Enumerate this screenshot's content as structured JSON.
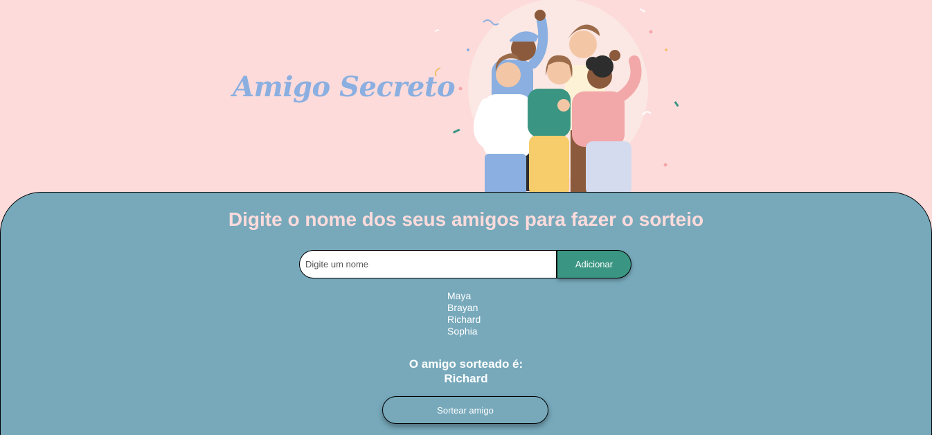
{
  "header": {
    "title": "Amigo Secreto"
  },
  "main": {
    "subtitle": "Digite o nome dos seus amigos para fazer o sorteio",
    "input_placeholder": "Digite um nome",
    "add_button_label": "Adicionar",
    "friends": [
      "Maya",
      "Brayan",
      "Richard",
      "Sophia"
    ],
    "result_label": "O amigo sorteado é:",
    "result_name": "Richard",
    "draw_button_label": "Sortear amigo"
  },
  "colors": {
    "background": "#fddbdb",
    "panel": "#77a9bb",
    "title": "#8aafe0",
    "add_button": "#3a9682"
  },
  "icons": {
    "illustration": "group-of-friends-illustration"
  }
}
